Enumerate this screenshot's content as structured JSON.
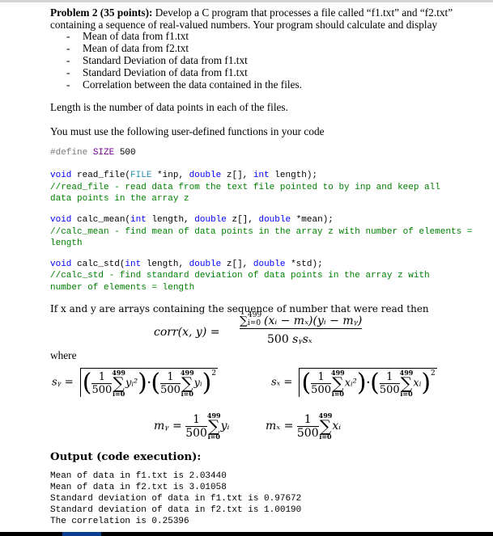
{
  "problem": {
    "title_bold": "Problem 2 (35 points):",
    "intro_line1": " Develop a C program that processes a file called “f1.txt” and “f2.txt”",
    "intro_line2": "containing a sequence of real-valued numbers. Your program should calculate and display",
    "bullet_dash": "-",
    "bullets": [
      "Mean of data from f1.txt",
      "Mean of data from f2.txt",
      "Standard Deviation of data from f1.txt",
      "Standard Deviation of data from f1.txt",
      "Correlation between the data contained in the files."
    ],
    "length_note": "Length is the number of data points in each of the files.",
    "must_use": "You must use the following user-defined functions in your code"
  },
  "code": {
    "define": {
      "directive": "#define ",
      "name": "SIZE",
      "value": " 500"
    },
    "read_file": {
      "kw_void": "void",
      "fn_open": " read_file(",
      "type_file": "FILE",
      "p1": " *inp, ",
      "kw_double": "double",
      "p2": " z[], ",
      "kw_int": "int",
      "p3": " length);",
      "comment1": "//read_file - read data from the text file pointed to by inp and keep all",
      "comment2": "data points in the array z"
    },
    "calc_mean": {
      "kw_void": "void",
      "fn_open": " calc_mean(",
      "kw_int": "int",
      "p1": " length, ",
      "kw_double1": "double",
      "p2": " z[], ",
      "kw_double2": "double",
      "p3": " *mean);",
      "comment1": "//calc_mean - find mean of data points in the array z with number of elements =",
      "comment2": "length"
    },
    "calc_std": {
      "kw_void": "void",
      "fn_open": " calc_std(",
      "kw_int": "int",
      "p1": " length, ",
      "kw_double1": "double",
      "p2": " z[], ",
      "kw_double2": "double",
      "p3": " *std);",
      "comment1": "//calc_std - find standard deviation of data points in the array z with",
      "comment2": "number of elements = length"
    }
  },
  "math": {
    "intro": "If x and y are arrays containing the sequence of number that were read then",
    "corr_lhs": "corr(x, y) =",
    "corr_sum": "∑",
    "corr_upper": "499",
    "corr_lower": "i=0",
    "corr_numerator": "(xᵢ − mₓ)(yᵢ − mᵧ)",
    "corr_den_num": "500 ",
    "corr_den_vars": "sᵧsₓ",
    "where": "where",
    "sy_lhs": "sᵧ =",
    "sx_lhs": "sₓ =",
    "one": "1",
    "n": "500",
    "upper": "499",
    "lower": "i=0",
    "sigma": "∑",
    "y_sq": "yᵢ²",
    "y_i": "yᵢ",
    "x_sq": "xᵢ²",
    "x_i": "xᵢ",
    "dot": "·",
    "sq": "2",
    "my_lhs": "mᵧ =",
    "mx_lhs": "mₓ ="
  },
  "output": {
    "heading": "Output (code execution):",
    "lines": [
      "Mean of data in f1.txt is 2.03440",
      "Mean of data in f2.txt is 3.01058",
      "Standard deviation of data in f1.txt is 0.97672",
      "Standard deviation of data in f2.txt is 1.00190",
      "The correlation is 0.25396"
    ]
  },
  "colors": {
    "keyword": "#0000ff",
    "type": "#2b91af",
    "macro": "#6f008a",
    "comment": "#008000"
  }
}
